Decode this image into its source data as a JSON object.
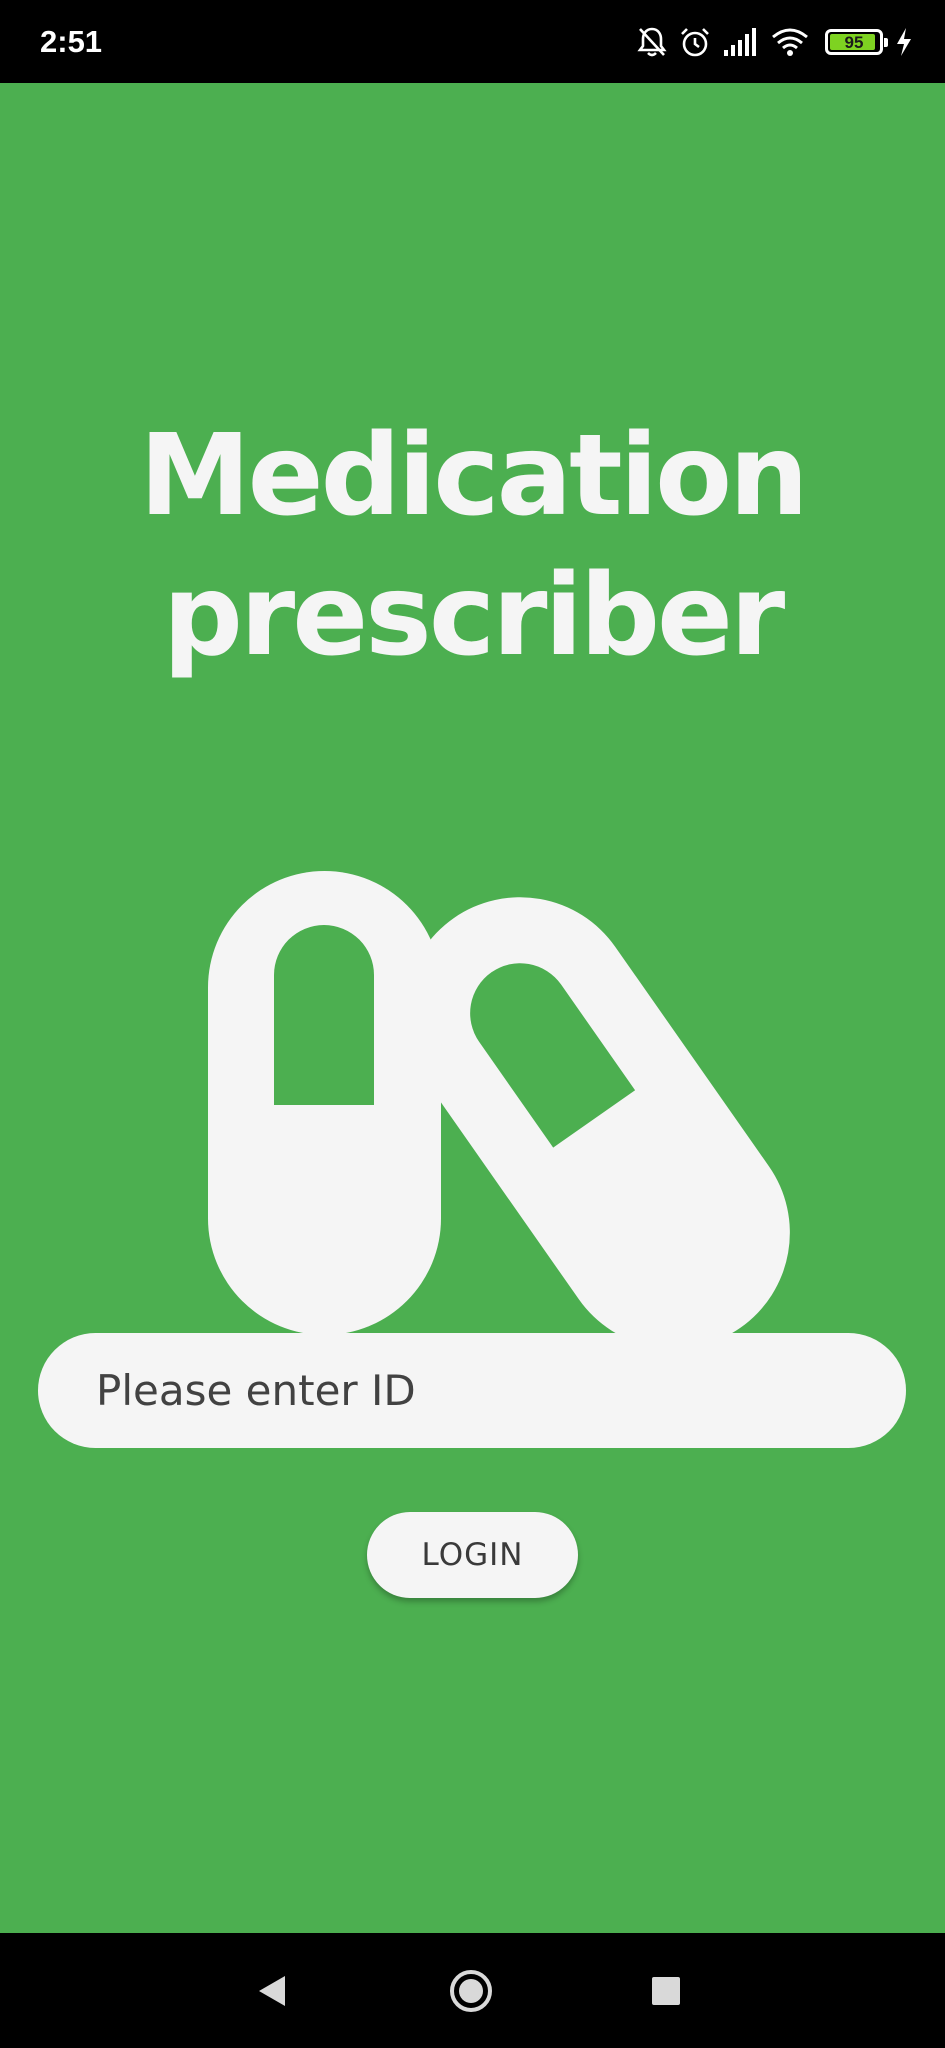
{
  "status_bar": {
    "time": "2:51",
    "battery_level": "95",
    "battery_fraction": 0.95,
    "icons": [
      "bell-off-icon",
      "alarm-icon",
      "signal-icon",
      "wifi-icon",
      "battery-icon",
      "charging-icon"
    ]
  },
  "app": {
    "title_line1": "Medication",
    "title_line2": "prescriber",
    "illustration_icon": "pills-icon",
    "id_input": {
      "value": "",
      "placeholder": "Please enter ID"
    },
    "login_label": "LOGIN"
  },
  "nav_bar": {
    "icons": [
      "back-icon",
      "home-icon",
      "recents-icon"
    ]
  },
  "colors": {
    "background": "#4caf50",
    "foreground": "#f5f5f5",
    "system_bar": "#000000",
    "battery_fill": "#7ed321"
  }
}
